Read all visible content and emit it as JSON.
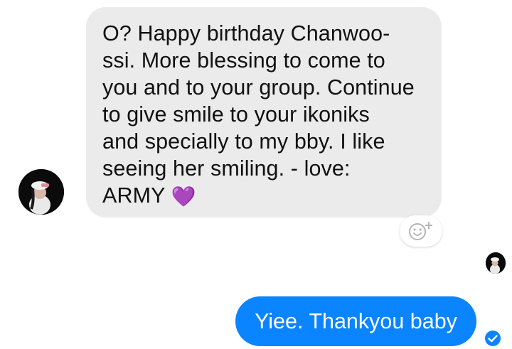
{
  "messages": {
    "incoming": {
      "text": "O? Happy birthday Chanwoo-\nssi. More blessing to come to\nyou and to your group. Continue\nto give smile to your ikoniks\nand specially to my bby. I like\nseeing her smiling. - love:\nARMY ",
      "emoji": "💜",
      "avatar_icon": "profile-photo",
      "reaction_icon": "add-reaction-icon"
    },
    "read_receipt": {
      "avatar_icon": "read-receipt-avatar"
    },
    "outgoing": {
      "text": "Yiee. Thankyou baby",
      "status_icon": "sent-check-icon"
    }
  },
  "colors": {
    "incoming_bubble": "#ebebeb",
    "outgoing_bubble": "#0a84ff",
    "heart": "#9a6fd6"
  }
}
